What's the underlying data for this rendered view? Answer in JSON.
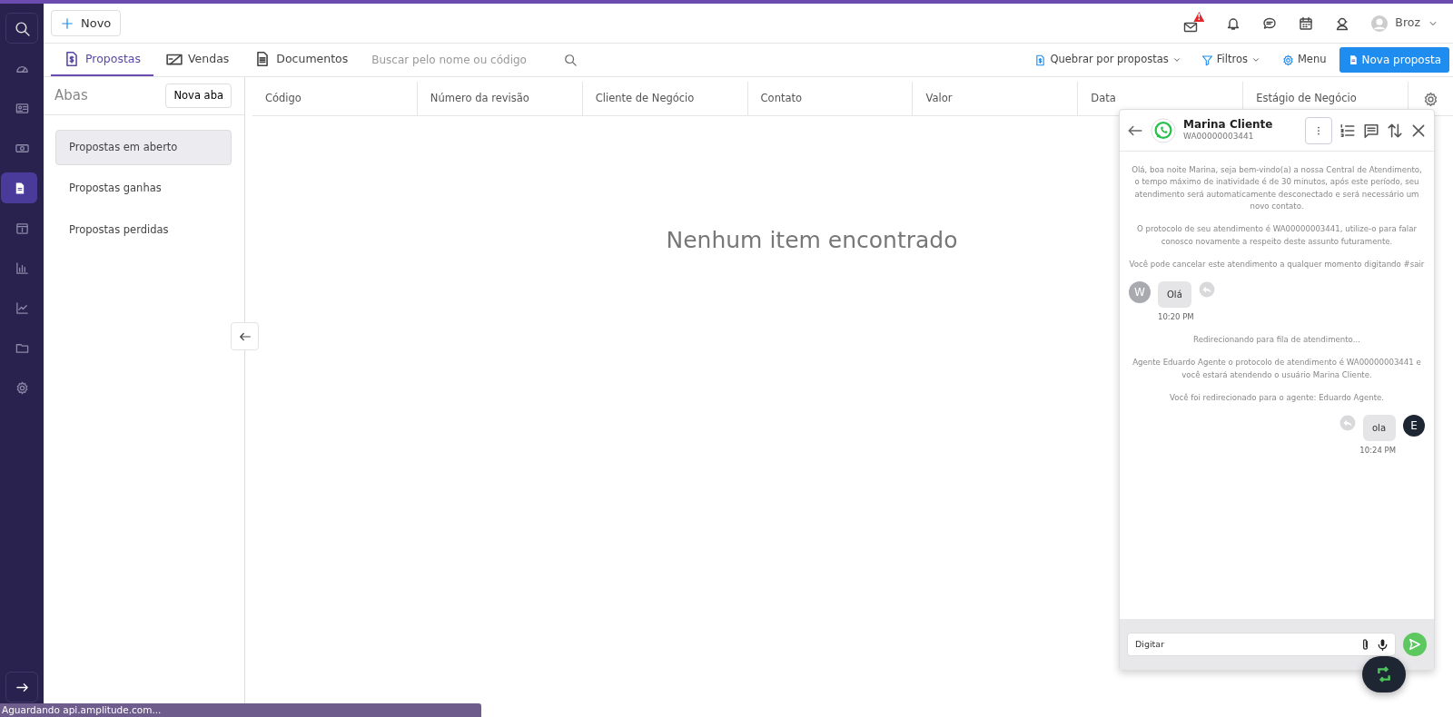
{
  "sidebar": {
    "items": [
      {
        "selected": false
      },
      {
        "selected": false
      },
      {
        "selected": false
      },
      {
        "selected": false
      },
      {
        "selected": true
      },
      {
        "selected": false
      },
      {
        "selected": false
      },
      {
        "selected": false
      },
      {
        "selected": false
      },
      {
        "selected": false
      }
    ]
  },
  "header": {
    "new_button": "Novo",
    "mail_badge": "!",
    "user": "Broz"
  },
  "tabs": [
    {
      "label": "Propostas",
      "selected": true
    },
    {
      "label": "Vendas",
      "selected": false
    },
    {
      "label": "Documentos",
      "selected": false
    }
  ],
  "search": {
    "placeholder": "Buscar pelo nome ou código"
  },
  "toolbar": {
    "group_by": "Quebrar por propostas",
    "filters": "Filtros",
    "menu": "Menu",
    "new_proposal": "Nova proposta"
  },
  "tabs_panel": {
    "title": "Abas",
    "new_tab": "Nova aba",
    "items": [
      {
        "label": "Propostas em aberto",
        "selected": true
      },
      {
        "label": "Propostas ganhas",
        "selected": false
      },
      {
        "label": "Propostas perdidas",
        "selected": false
      }
    ]
  },
  "table": {
    "columns": [
      "Código",
      "Número da revisão",
      "Cliente de Negócio",
      "Contato",
      "Valor",
      "Data",
      "Estágio de Negócio"
    ],
    "empty": "Nenhum item encontrado"
  },
  "chat": {
    "name": "Marina Cliente",
    "protocol": "WA00000003441",
    "composer_placeholder": "Digitar",
    "messages": [
      {
        "kind": "system",
        "text": "Olá, boa noite Marina, seja bem-vindo(a) a nossa Central de Atendimento, o tempo máximo de inatividade é de 30 minutos, após este período, seu atendimento será automaticamente desconectado e será necessário um novo contato."
      },
      {
        "kind": "system",
        "text": "O protocolo de seu atendimento é WA00000003441, utilize-o para falar conosco novamente a respeito deste assunto futuramente."
      },
      {
        "kind": "system",
        "text": "Você pode cancelar este atendimento a qualquer momento digitando #sair"
      },
      {
        "kind": "incoming",
        "avatar": "W",
        "text": "Olá",
        "time": "10:20 PM"
      },
      {
        "kind": "system",
        "text": "Redirecionando para fila de atendimento..."
      },
      {
        "kind": "system",
        "text": "Agente Eduardo Agente o protocolo de atendimento é WA00000003441 e você estará atendendo o usuário Marina Cliente."
      },
      {
        "kind": "system",
        "text": "Você foi redirecionado para o agente: Eduardo Agente."
      },
      {
        "kind": "outgoing",
        "avatar": "E",
        "text": "ola",
        "time": "10:24 PM"
      }
    ]
  },
  "status_bar": "Aguardando api.amplitude.com..."
}
